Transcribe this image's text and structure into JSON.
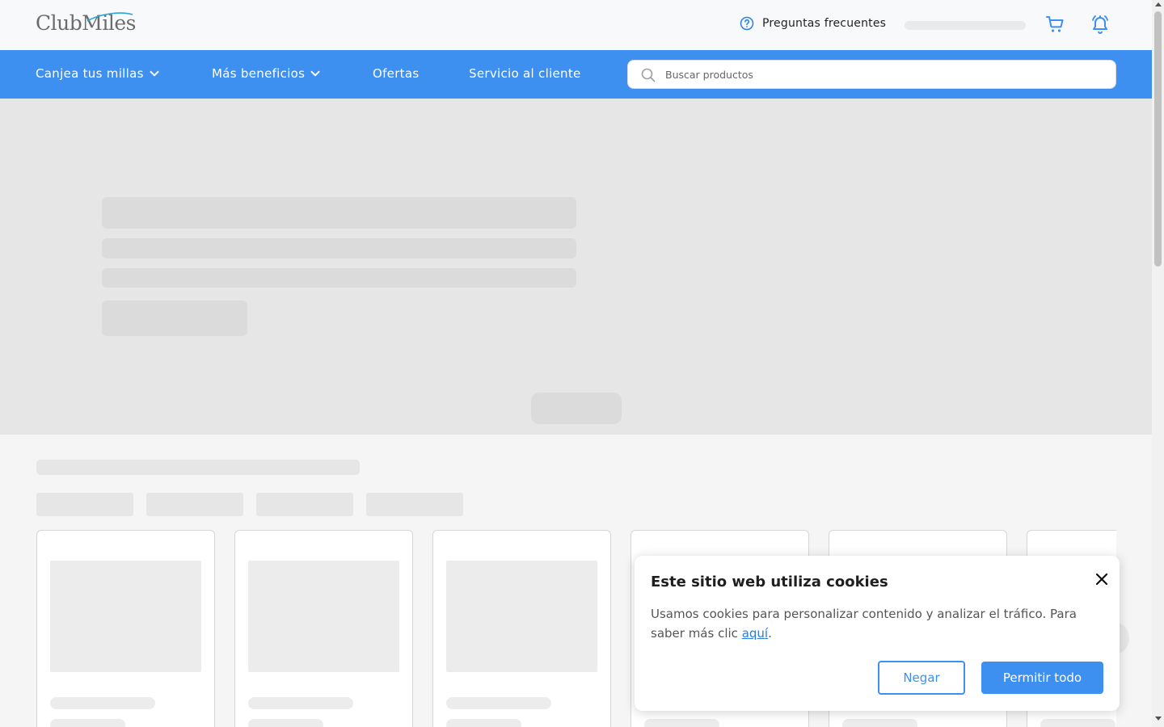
{
  "header": {
    "logo_text": "ClubMiles",
    "faq_label": "Preguntas frecuentes",
    "icons": [
      "help-circle-icon",
      "cart-icon",
      "bell-icon"
    ]
  },
  "nav": {
    "items": [
      {
        "label": "Canjea tus millas",
        "has_dropdown": true
      },
      {
        "label": "Más beneficios",
        "has_dropdown": true
      },
      {
        "label": "Ofertas",
        "has_dropdown": false
      },
      {
        "label": "Servicio al cliente",
        "has_dropdown": false
      }
    ],
    "search": {
      "placeholder": "Buscar productos",
      "value": ""
    }
  },
  "cookie_banner": {
    "title": "Este sitio web utiliza cookies",
    "body": "Usamos cookies para personalizar contenido y analizar el tráfico. Para saber más clic ",
    "link_text": "aquí",
    "body_end": ".",
    "deny_label": "Negar",
    "allow_label": "Permitir todo"
  },
  "colors": {
    "brand_blue": "#3d8ff0",
    "header_bg": "#f8f9fb",
    "skeleton": "#e6e6e6"
  }
}
